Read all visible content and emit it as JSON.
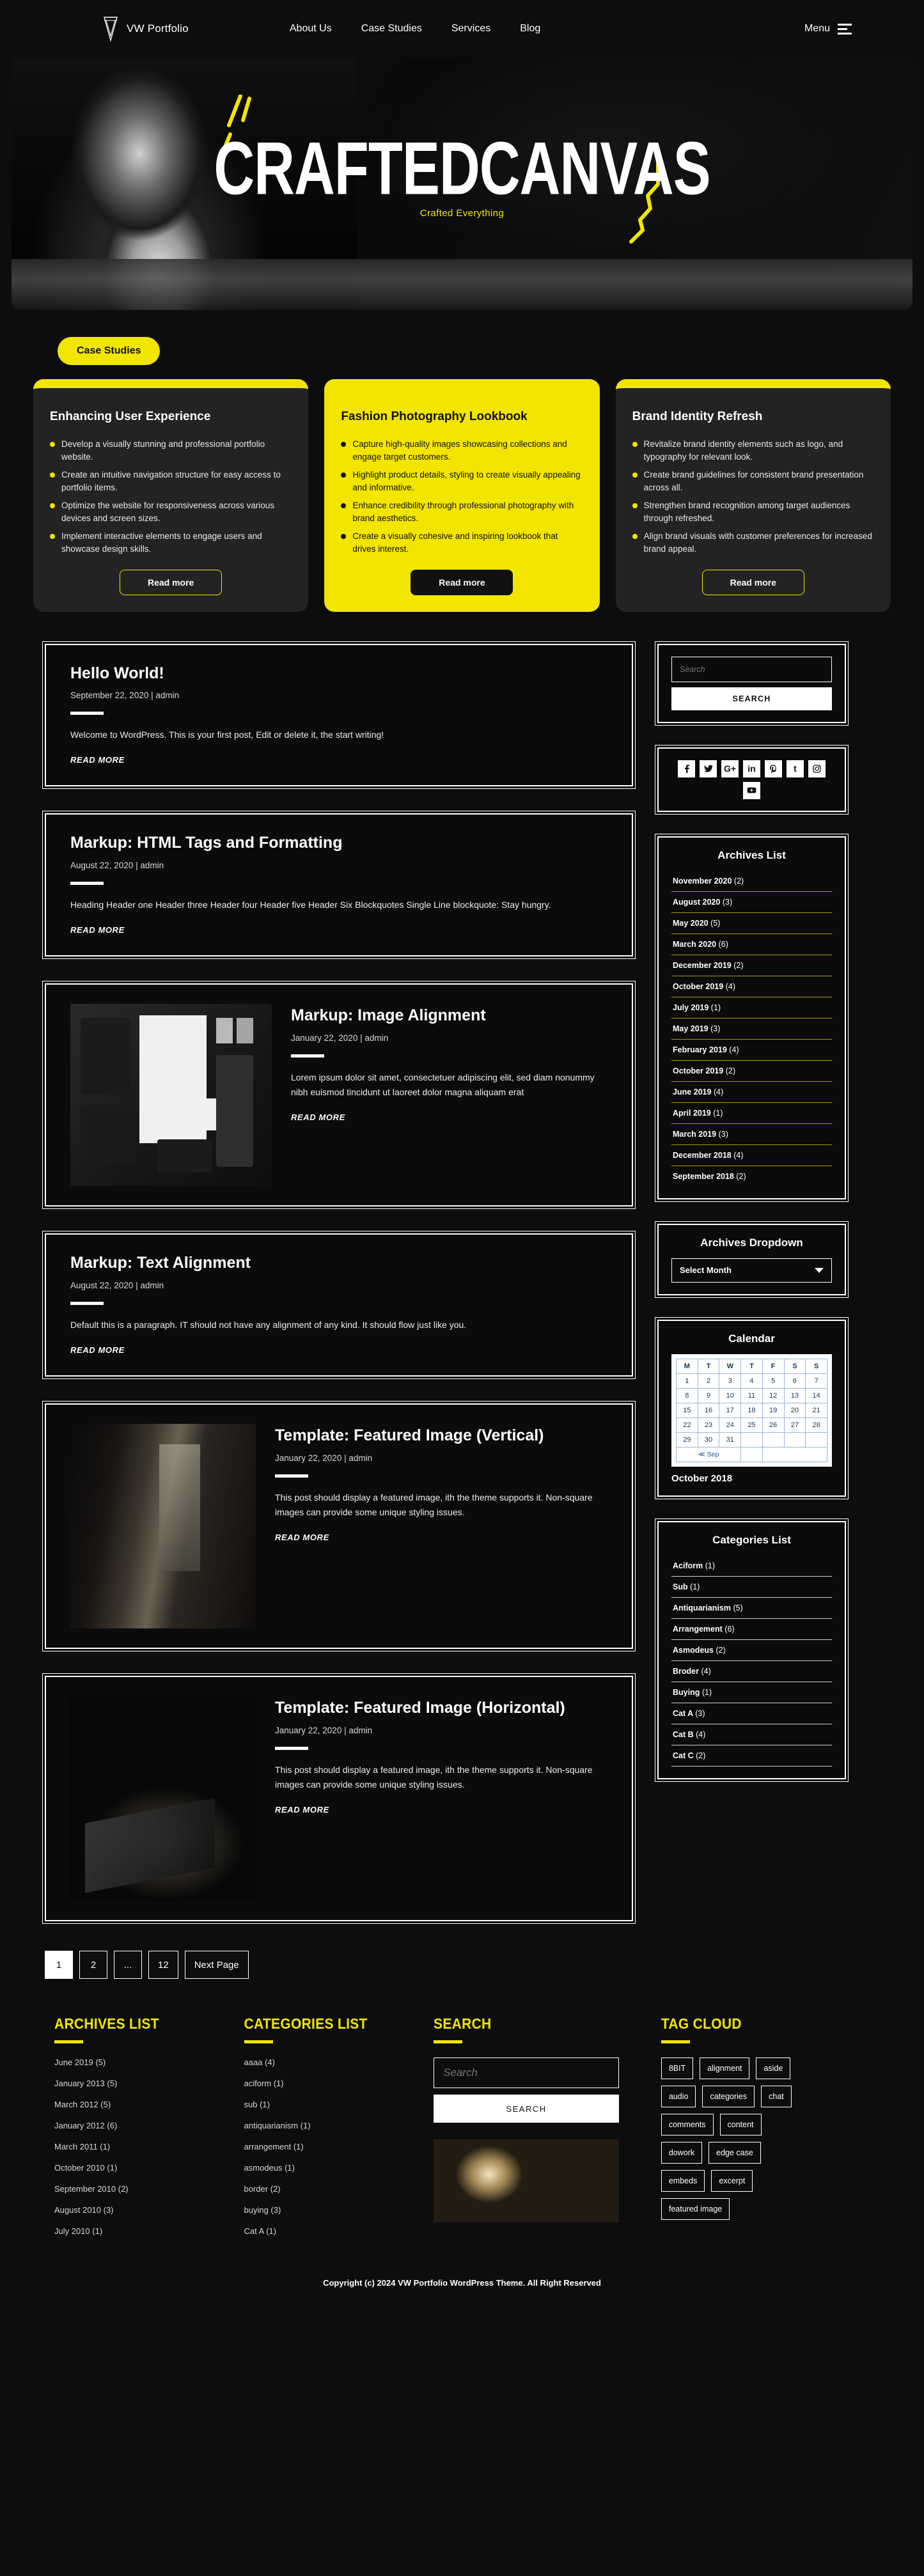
{
  "header": {
    "brand": "VW Portfolio",
    "logo_icon": "triangle-logo-icon",
    "nav": [
      {
        "label": "About Us"
      },
      {
        "label": "Case Studies"
      },
      {
        "label": "Services"
      },
      {
        "label": "Blog"
      }
    ],
    "menu_label": "Menu",
    "menu_icon": "hamburger-menu-icon"
  },
  "hero": {
    "title": "CRAFTEDCANVAS",
    "subtitle": "Crafted Everything"
  },
  "case_studies": {
    "badge": "Case Studies",
    "cards": [
      {
        "theme": "dark",
        "title": "Enhancing User Experience",
        "bullets": [
          "Develop a visually stunning and professional portfolio website.",
          "Create an intuitive navigation structure for easy access to portfolio items.",
          "Optimize the website for responsiveness across various devices and screen sizes.",
          "Implement interactive elements to engage users and showcase design skills."
        ],
        "button": "Read more"
      },
      {
        "theme": "yellow",
        "title": "Fashion Photography Lookbook",
        "bullets": [
          "Capture high-quality images showcasing collections and engage target customers.",
          "Highlight product details, styling to create visually appealing and informative.",
          "Enhance credibility through professional photography with brand aesthetics.",
          "Create a visually cohesive and inspiring lookbook that drives interest."
        ],
        "button": "Read more"
      },
      {
        "theme": "dark",
        "title": "Brand Identity Refresh",
        "bullets": [
          "Revitalize brand identity elements such as logo, and typography for relevant look.",
          "Create brand guidelines for consistent brand presentation across all.",
          "Strengthen brand recognition among target audiences through refreshed.",
          "Align brand visuals with customer preferences for increased brand appeal."
        ],
        "button": "Read more"
      }
    ]
  },
  "posts": [
    {
      "title": "Hello World!",
      "meta": "September 22, 2020 | admin",
      "excerpt": "Welcome to WordPress. This is your first post, Edit or delete it, the start writing!",
      "readmore": "READ MORE",
      "thumb": null
    },
    {
      "title": "Markup: HTML Tags and Formatting",
      "meta": "August 22, 2020 | admin",
      "excerpt": "Heading Header one Header three Header four Header five Header Six Blockquotes Single Line blockquote: Stay hungry.",
      "readmore": "READ MORE",
      "thumb": null
    },
    {
      "title": "Markup: Image Alignment",
      "meta": "January 22, 2020 | admin",
      "excerpt": "Lorem ipsum dolor sit amet, consectetuer adipiscing elit, sed diam nonummy nibh euismod tincidunt ut laoreet dolor magna aliquam erat",
      "readmore": "READ MORE",
      "thumb": "stationery-mockup-image"
    },
    {
      "title": "Markup: Text Alignment",
      "meta": "August 22, 2020 | admin",
      "excerpt": "Default this is a paragraph. IT should not have any alignment of any kind. It should flow just like you.",
      "readmore": "READ MORE",
      "thumb": null
    },
    {
      "title": "Template: Featured Image (Vertical)",
      "meta": "January 22, 2020 | admin",
      "excerpt": "This post should display a featured image, ith the theme supports it. Non-square images can provide some unique styling issues.",
      "readmore": "READ MORE",
      "thumb": "woman-at-window-image"
    },
    {
      "title": "Template: Featured Image (Horizontal)",
      "meta": "January 22, 2020 | admin",
      "excerpt": "This post should display a featured image, ith the theme supports it. Non-square images can provide some unique styling issues.",
      "readmore": "READ MORE",
      "thumb": "hands-on-laptop-image"
    }
  ],
  "pagination": {
    "pages": [
      "1",
      "2",
      "...",
      "12"
    ],
    "current": "1",
    "next_label": "Next Page"
  },
  "sidebar": {
    "search": {
      "placeholder": "Search",
      "value": "",
      "button": "SEARCH"
    },
    "social": [
      {
        "name": "facebook-icon",
        "glyph": "f"
      },
      {
        "name": "twitter-icon",
        "glyph": "ᵗ"
      },
      {
        "name": "google-plus-icon",
        "glyph": "G+"
      },
      {
        "name": "linkedin-icon",
        "glyph": "in"
      },
      {
        "name": "pinterest-icon",
        "glyph": "ᴘ"
      },
      {
        "name": "tumblr-icon",
        "glyph": "t"
      },
      {
        "name": "instagram-icon",
        "glyph": "▢"
      },
      {
        "name": "youtube-icon",
        "glyph": "▶"
      }
    ],
    "archives_list": {
      "title": "Archives List",
      "items": [
        {
          "label": "November 2020",
          "count": "(2)"
        },
        {
          "label": "August 2020",
          "count": "(3)"
        },
        {
          "label": "May 2020",
          "count": "(5)"
        },
        {
          "label": "March 2020",
          "count": "(6)"
        },
        {
          "label": "December 2019",
          "count": "(2)"
        },
        {
          "label": "October 2019",
          "count": "(4)"
        },
        {
          "label": "July 2019",
          "count": "(1)"
        },
        {
          "label": "May 2019",
          "count": "(3)"
        },
        {
          "label": "February 2019",
          "count": "(4)"
        },
        {
          "label": "October 2019",
          "count": "(2)"
        },
        {
          "label": "June 2019",
          "count": "(4)"
        },
        {
          "label": "April 2019",
          "count": "(1)"
        },
        {
          "label": "March 2019",
          "count": "(3)"
        },
        {
          "label": "December 2018",
          "count": "(4)"
        },
        {
          "label": "September 2018",
          "count": "(2)"
        }
      ]
    },
    "archives_dropdown": {
      "title": "Archives Dropdown",
      "selected": "Select Month",
      "caret_icon": "chevron-down-icon"
    },
    "calendar": {
      "title": "Calendar",
      "caption": "October 2018",
      "weekdays": [
        "M",
        "T",
        "W",
        "T",
        "F",
        "S",
        "S"
      ],
      "weeks": [
        [
          "1",
          "2",
          "3",
          "4",
          "5",
          "6",
          "7"
        ],
        [
          "8",
          "9",
          "10",
          "11",
          "12",
          "13",
          "14"
        ],
        [
          "15",
          "16",
          "17",
          "18",
          "19",
          "20",
          "21"
        ],
        [
          "22",
          "23",
          "24",
          "25",
          "26",
          "27",
          "28"
        ],
        [
          "29",
          "30",
          "31",
          "",
          "",
          "",
          ""
        ]
      ],
      "prev_label": "≪ Sep"
    },
    "categories_list": {
      "title": "Categories List",
      "items": [
        {
          "label": "Aciform",
          "count": "(1)"
        },
        {
          "label": "Sub",
          "count": "(1)"
        },
        {
          "label": "Antiquarianism",
          "count": "(5)"
        },
        {
          "label": "Arrangement",
          "count": "(6)"
        },
        {
          "label": "Asmodeus",
          "count": "(2)"
        },
        {
          "label": "Broder",
          "count": "(4)"
        },
        {
          "label": "Buying",
          "count": "(1)"
        },
        {
          "label": "Cat A",
          "count": "(3)"
        },
        {
          "label": "Cat B",
          "count": "(4)"
        },
        {
          "label": "Cat C",
          "count": "(2)"
        }
      ]
    }
  },
  "footer": {
    "archives": {
      "title": "ARCHIVES LIST",
      "items": [
        "June 2019 (5)",
        "January  2013 (5)",
        "March 2012 (5)",
        "January  2012 (6)",
        "March  2011 (1)",
        "October 2010 (1)",
        "September 2010 (2)",
        "August 2010 (3)",
        "July 2010 (1)"
      ]
    },
    "categories": {
      "title": "CATEGORIES LIST",
      "items": [
        "aaaa (4)",
        "aciform (1)",
        "sub (1)",
        "antiquarianism (1)",
        "arrangement (1)",
        "asmodeus (1)",
        "border (2)",
        "buying (3)",
        "Cat A (1)"
      ]
    },
    "search": {
      "title": "SEARCH",
      "placeholder": "Search",
      "value": "",
      "button": "SEARCH",
      "image": "person-at-desk-with-dog-image"
    },
    "tags": {
      "title": "TAG CLOUD",
      "items": [
        "8BIT",
        "alignment",
        "aside",
        "audio",
        "categories",
        "chat",
        "comments",
        "content",
        "dowork",
        "edge case",
        "embeds",
        "excerpt",
        "featured image"
      ]
    },
    "copyright": "Copyright (c) 2024 VW Portfolio WordPress Theme. All Right Reserved"
  },
  "colors": {
    "accent": "#f2e500",
    "background": "#0d0d0d",
    "card_dark": "#232323",
    "text": "#ffffff"
  }
}
